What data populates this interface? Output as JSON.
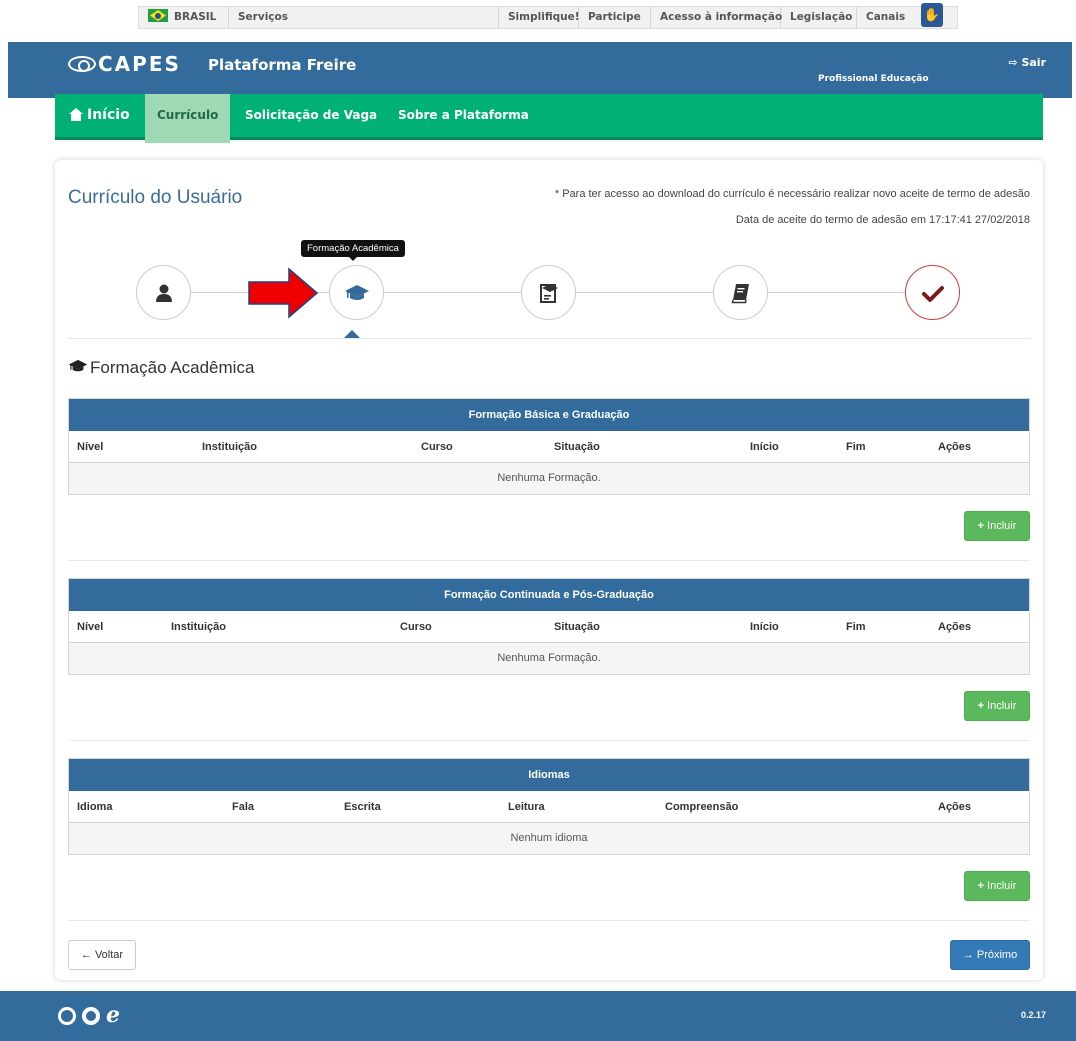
{
  "govbar": {
    "brasil": "BRASIL",
    "servicos": "Serviços",
    "links": [
      "Simplifique!",
      "Participe",
      "Acesso à informação",
      "Legislação",
      "Canais"
    ]
  },
  "header": {
    "logo": "CAPES",
    "platform": "Plataforma Freire",
    "logout": "Sair",
    "profile": "Profissional Educação"
  },
  "nav": {
    "home": "Início",
    "items": [
      "Currículo",
      "Solicitação de Vaga",
      "Sobre a Plataforma"
    ]
  },
  "page": {
    "title": "Currículo do Usuário",
    "note_download": "* Para ter acesso ao download do currículo é necessário realizar novo aceite de termo de adesão",
    "note_date": "Data de aceite do termo de adesão em 17:17:41 27/02/2018",
    "tooltip": "Formação Acadêmica",
    "section_title": "Formação Acadêmica"
  },
  "steps": [
    "user-icon",
    "graduation-cap-icon",
    "certificate-icon",
    "book-icon",
    "check-icon"
  ],
  "tables": {
    "basic": {
      "title": "Formação Básica e Graduação",
      "columns": [
        "Nível",
        "Instituição",
        "Curso",
        "Situação",
        "Início",
        "Fim",
        "Ações"
      ],
      "empty": "Nenhuma Formação."
    },
    "continued": {
      "title": "Formação Continuada e Pós-Graduação",
      "columns": [
        "Nível",
        "Instituição",
        "Curso",
        "Situação",
        "Início",
        "Fim",
        "Ações"
      ],
      "empty": "Nenhuma Formação."
    },
    "languages": {
      "title": "Idiomas",
      "columns": [
        "Idioma",
        "Fala",
        "Escrita",
        "Leitura",
        "Compreensão",
        "Ações"
      ],
      "empty": "Nenhum idioma"
    }
  },
  "buttons": {
    "include": "Incluir",
    "back": "Voltar",
    "next": "Próximo"
  },
  "footer": {
    "version": "0.2.17"
  },
  "colors": {
    "primary": "#336b9c",
    "nav_green": "#00b074",
    "success": "#5cb85c",
    "next_blue": "#337ab7",
    "check_red": "#d23b3b"
  }
}
